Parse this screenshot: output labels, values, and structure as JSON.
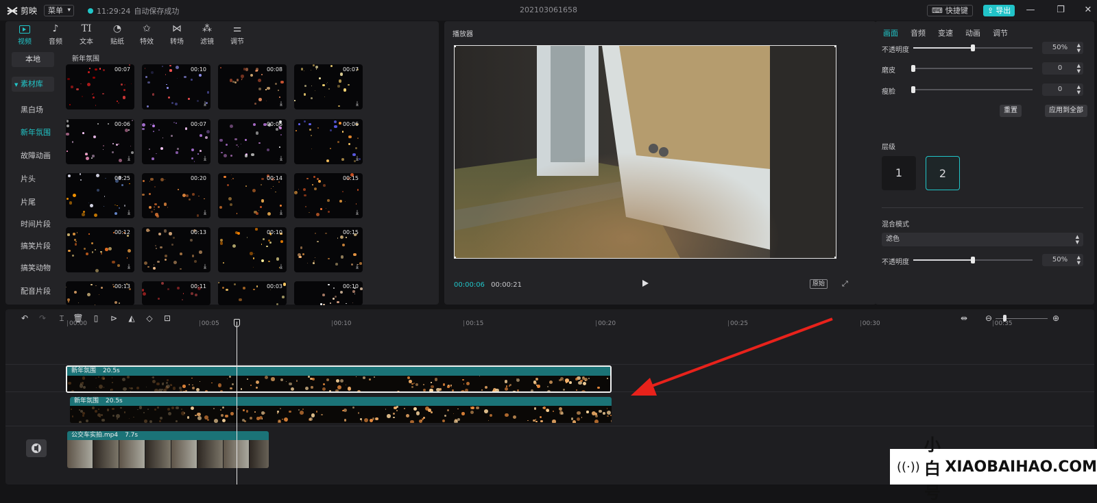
{
  "app": {
    "name": "剪映",
    "menu_label": "菜单",
    "save_time": "11:29:24",
    "save_text": "自动保存成功",
    "project_title": "202103061658",
    "hotkey_label": "快捷键",
    "export_label": "导出"
  },
  "tools": [
    {
      "label": "视频",
      "icon": "video-icon",
      "active": true
    },
    {
      "label": "音频",
      "icon": "audio-icon"
    },
    {
      "label": "文本",
      "icon": "text-icon"
    },
    {
      "label": "贴纸",
      "icon": "sticker-icon"
    },
    {
      "label": "特效",
      "icon": "effects-icon"
    },
    {
      "label": "转场",
      "icon": "transition-icon"
    },
    {
      "label": "滤镜",
      "icon": "filter-icon"
    },
    {
      "label": "调节",
      "icon": "adjust-icon"
    }
  ],
  "sidebar": {
    "local_label": "本地",
    "library_label": "素材库",
    "items": [
      "黑白场",
      "新年氛围",
      "故障动画",
      "片头",
      "片尾",
      "时间片段",
      "搞笑片段",
      "搞笑动物",
      "配音片段"
    ],
    "active_item": "新年氛围"
  },
  "media": {
    "section_title": "新年氛围",
    "thumbs": [
      {
        "duration": "00:07"
      },
      {
        "duration": "00:10"
      },
      {
        "duration": "00:08"
      },
      {
        "duration": "00:07"
      },
      {
        "duration": "00:06"
      },
      {
        "duration": "00:07"
      },
      {
        "duration": "00:06"
      },
      {
        "duration": "00:06"
      },
      {
        "duration": "00:25"
      },
      {
        "duration": "00:20"
      },
      {
        "duration": "00:14"
      },
      {
        "duration": "00:15"
      },
      {
        "duration": "00:12"
      },
      {
        "duration": "00:13"
      },
      {
        "duration": "00:10"
      },
      {
        "duration": "00:15"
      },
      {
        "duration": "00:13"
      },
      {
        "duration": "00:11"
      },
      {
        "duration": "00:03"
      },
      {
        "duration": "00:10"
      }
    ]
  },
  "player": {
    "title": "播放器",
    "current_time": "00:00:06",
    "total_time": "00:00:21",
    "ratio_label": "原始"
  },
  "props": {
    "tabs": [
      "画面",
      "音频",
      "变速",
      "动画",
      "调节"
    ],
    "active_tab": "画面",
    "opacity_label": "不透明度",
    "opacity_value": "50%",
    "opacity_fraction": 0.5,
    "smooth_label": "磨皮",
    "smooth_value": "0",
    "slim_label": "瘦脸",
    "slim_value": "0",
    "reset_label": "重置",
    "apply_all_label": "应用到全部",
    "layer_label": "层级",
    "layers": [
      "1",
      "2"
    ],
    "active_layer": "2",
    "blend_label": "混合模式",
    "blend_value": "滤色",
    "opacity2_label": "不透明度",
    "opacity2_value": "50%",
    "opacity2_fraction": 0.5
  },
  "timeline": {
    "ruler": [
      "00:00",
      "00:05",
      "00:10",
      "00:15",
      "00:20",
      "00:25",
      "00:30",
      "00:35"
    ],
    "clips": [
      {
        "name": "新年氛围",
        "duration": "20.5s",
        "selected": true
      },
      {
        "name": "新年氛围",
        "duration": "20.5s"
      },
      {
        "name": "公交车实拍.mp4",
        "duration": "7.7s"
      }
    ]
  },
  "watermark": {
    "text_cn": "小白号",
    "text_en": "XIAOBAIHAO.COM"
  },
  "colors": {
    "accent": "#21c6c9",
    "clip_header": "#1b7377",
    "arrow": "#e8221b"
  }
}
